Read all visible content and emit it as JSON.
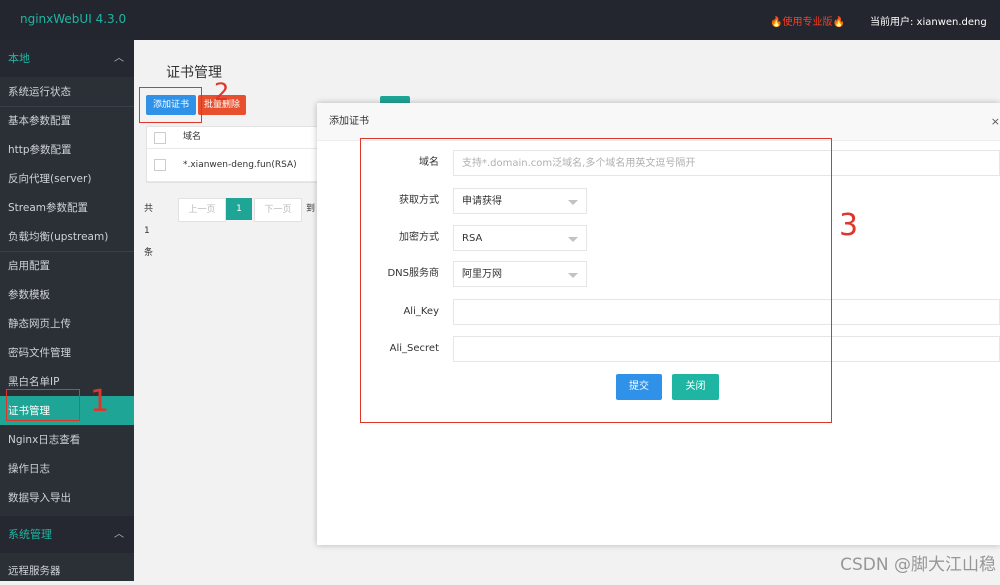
{
  "header": {
    "app_title": "nginxWebUI 4.3.0",
    "promo": "🔥使用专业版🔥",
    "current_user": "当前用户: xianwen.deng"
  },
  "sidebar": {
    "group_local": "本地",
    "items_group1": [
      "系统运行状态"
    ],
    "items_group2": [
      "基本参数配置",
      "http参数配置",
      "反向代理(server)",
      "Stream参数配置",
      "负载均衡(upstream)"
    ],
    "items_group3": [
      "启用配置",
      "参数模板",
      "静态网页上传",
      "密码文件管理",
      "黑白名单IP",
      "证书管理",
      "Nginx日志查看",
      "操作日志",
      "数据导入导出"
    ],
    "group_system": "系统管理",
    "items_system": [
      "远程服务器"
    ]
  },
  "main": {
    "title": "证书管理",
    "add_button": "添加证书",
    "batch_delete_button": "批量删除",
    "table": {
      "header_domain": "域名",
      "rows": [
        {
          "domain": "*.xianwen-deng.fun(RSA)"
        }
      ]
    },
    "pager": {
      "total": "共 1 条",
      "prev": "上一页",
      "current": "1",
      "next": "下一页",
      "goto": "到"
    }
  },
  "modal": {
    "title": "添加证书",
    "close": "×",
    "fields": {
      "domain": {
        "label": "域名",
        "placeholder": "支持*.domain.com泛域名,多个域名用英文逗号隔开"
      },
      "method": {
        "label": "获取方式",
        "value": "申请获得"
      },
      "encryption": {
        "label": "加密方式",
        "value": "RSA"
      },
      "dns": {
        "label": "DNS服务商",
        "value": "阿里万网"
      },
      "ali_key": {
        "label": "Ali_Key",
        "value": ""
      },
      "ali_secret": {
        "label": "Ali_Secret",
        "value": ""
      }
    },
    "submit": "提交",
    "close_button": "关闭"
  },
  "annotations": {
    "step1": "1",
    "step2": "2",
    "step3": "3"
  },
  "watermark": "CSDN @脚大江山稳"
}
